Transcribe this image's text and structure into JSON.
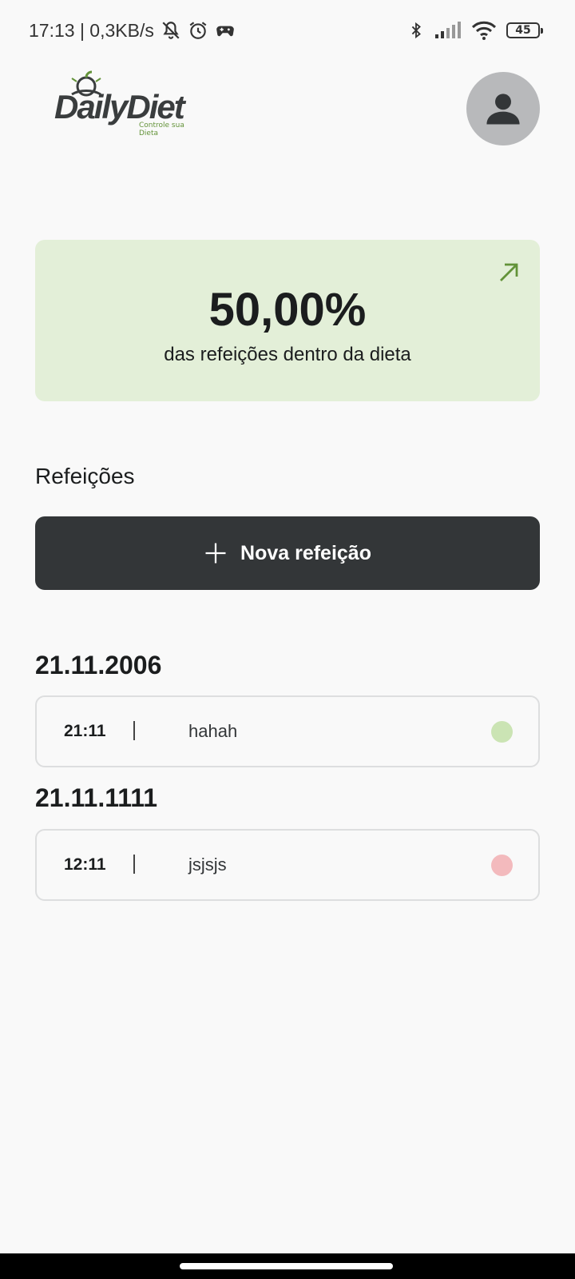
{
  "status_bar": {
    "time_speed": "17:13 | 0,3KB/s",
    "battery": "45",
    "icons": [
      "notifications-off-icon",
      "alarm-icon",
      "game-controller-icon",
      "bluetooth-icon",
      "signal-icon",
      "wifi-icon",
      "battery-icon"
    ]
  },
  "header": {
    "logo_title": "DailyDiet",
    "logo_subtitle": "Controle sua Dieta",
    "avatar_icon": "user-icon"
  },
  "stats": {
    "percent": "50,00%",
    "label": "das refeições dentro da dieta",
    "color": "#e3efd8",
    "arrow_color": "#639339",
    "arrow_icon": "arrow-up-right-icon"
  },
  "meals": {
    "title": "Refeições",
    "new_meal_label": "Nova refeição",
    "groups": [
      {
        "date": "21.11.2006",
        "items": [
          {
            "time": "21:11",
            "name": "hahah",
            "status": "in-diet",
            "dot_color": "#cbe4b4"
          }
        ]
      },
      {
        "date": "21.11.1111",
        "items": [
          {
            "time": "12:11",
            "name": "jsjsjs",
            "status": "off-diet",
            "dot_color": "#f3babd"
          }
        ]
      }
    ]
  }
}
